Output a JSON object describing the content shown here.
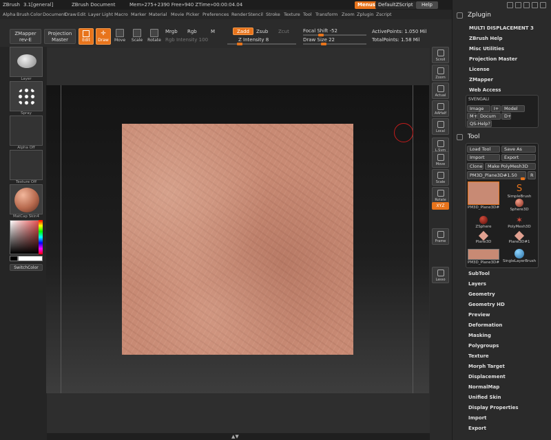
{
  "titlebar": {
    "app": "ZBrush",
    "version": "3.1[general]",
    "document": "ZBrush Document",
    "stats": "Mem»275+2390 Free»940 ZTime»00:00:04.04",
    "menus": "Menus",
    "script": "DefaultZScript",
    "help": "Help"
  },
  "menu": [
    "Alpha",
    "Brush",
    "Color",
    "Document",
    "Draw",
    "Edit",
    "Layer",
    "Light",
    "Macro",
    "Marker",
    "Material",
    "Movie",
    "Picker",
    "Preferences",
    "Render",
    "Stencil",
    "Stroke",
    "Texture",
    "Tool",
    "Transform",
    "Zoom",
    "Zplugin",
    "Zscript"
  ],
  "toolbar": {
    "zmapper": "ZMapper rev-E",
    "projection": "Projection Master",
    "edit": "Edit",
    "draw": "Draw",
    "move": "Move",
    "scale": "Scale",
    "rotate": "Rotate",
    "mrgb": "Mrgb",
    "rgb": "Rgb",
    "m": "M",
    "rgb_intensity": "Rgb Intensity 100",
    "zadd": "Zadd",
    "zsub": "Zsub",
    "zcut": "Zcut",
    "z_intensity": "Z Intensity 8",
    "focal_shift": "Focal Shift -52",
    "draw_size": "Draw Size 22",
    "focal_shift_value": 0.26,
    "draw_size_value": 0.31,
    "active_points": "ActivePoints: 1.050 Mil",
    "total_points": "TotalPoints: 1.58 Mil"
  },
  "left": {
    "layer": "Layer",
    "spray": "Spray",
    "alpha": "Alpha Off",
    "texture": "Texture Off",
    "matcap": "MatCap Skin4",
    "switch": "SwitchColor"
  },
  "right": [
    {
      "name": "scroll-icon",
      "label": "Scroll"
    },
    {
      "name": "zoom-icon",
      "label": "Zoom"
    },
    {
      "name": "actual-icon",
      "label": "Actual"
    },
    {
      "name": "aahalf-icon",
      "label": "AAHalf"
    },
    {
      "name": "local-icon",
      "label": "Local"
    },
    {
      "name": "lsym-icon",
      "label": "L.Sym"
    },
    {
      "name": "move-icon",
      "label": "Move"
    },
    {
      "name": "scale-icon",
      "label": "Scale"
    },
    {
      "name": "rotate-icon",
      "label": "Rotate"
    },
    {
      "name": "frame-icon",
      "label": "Frame"
    },
    {
      "name": "lasso-icon",
      "label": "Lasso"
    }
  ],
  "right_xyz": "XYZ",
  "zplugin": {
    "title": "Zplugin",
    "items": [
      "MULTI DISPLACEMENT 3",
      "ZBrush Help",
      "Misc Utilities",
      "Projection Master",
      "License",
      "ZMapper",
      "Web Access"
    ],
    "svengali": "SVENGALI",
    "buttons": [
      "Image",
      "I+",
      "Model",
      "M+",
      "Docum",
      "D+",
      "QS-Help?"
    ]
  },
  "tool": {
    "title": "Tool",
    "load": "Load Tool",
    "save": "Save As",
    "import": "Import",
    "export": "Export",
    "clone": "Clone",
    "make": "Make PolyMesh3D",
    "current": "PM3D_Plane3D#1.50",
    "r": "R",
    "palette": [
      "PM3D_Plane3D#",
      "SimpleBrush",
      "Sphere3D",
      "ZSphere",
      "PolyMesh3D",
      "Plane3D",
      "Plane3D#1",
      "PM3D_Plane3D#",
      "SingleLayerBrush"
    ],
    "subpalettes": [
      "SubTool",
      "Layers",
      "Geometry",
      "Geometry HD",
      "Preview",
      "Deformation",
      "Masking",
      "Polygroups",
      "Texture",
      "Morph Target",
      "Displacement",
      "NormalMap",
      "Unified Skin",
      "Display Properties",
      "Import",
      "Export"
    ]
  },
  "colors": {
    "accent": "#e8741c",
    "clay": "#c88a74",
    "cursor": "#c21c1c"
  }
}
